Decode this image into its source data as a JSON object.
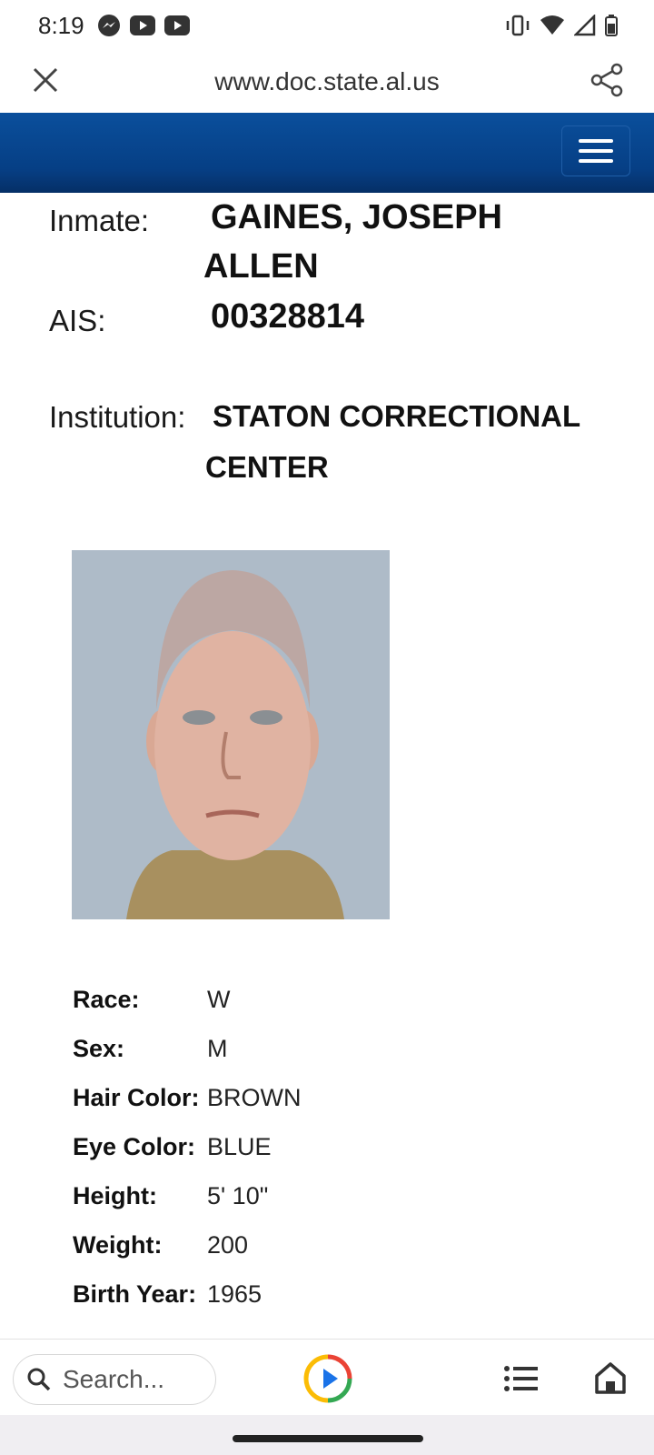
{
  "status": {
    "time": "8:19",
    "icons": [
      "messenger-icon",
      "youtube-icon",
      "youtube-icon",
      "vibrate-icon",
      "wifi-icon",
      "signal-icon",
      "battery-icon"
    ]
  },
  "browser": {
    "url": "www.doc.state.al.us",
    "icons": [
      "close-icon",
      "share-icon"
    ]
  },
  "site": {
    "header_color": "#063f85",
    "menu_icon": "hamburger-icon"
  },
  "inmate": {
    "name_label": "Inmate:",
    "name_line1": "GAINES, JOSEPH",
    "name_line2": "ALLEN",
    "ais_label": "AIS:",
    "ais": "00328814",
    "institution_label": "Institution:",
    "institution_line1": "STATON CORRECTIONAL",
    "institution_line2": "CENTER"
  },
  "attributes": [
    {
      "label": "Race:",
      "value": "W"
    },
    {
      "label": "Sex:",
      "value": "M"
    },
    {
      "label": "Hair Color:",
      "value": "BROWN"
    },
    {
      "label": "Eye Color:",
      "value": "BLUE"
    },
    {
      "label": "Height:",
      "value": "5' 10\""
    },
    {
      "label": "Weight:",
      "value": "200"
    },
    {
      "label": "Birth Year:",
      "value": "1965"
    }
  ],
  "bottom": {
    "search_placeholder": "Search...",
    "icons": [
      "search-icon",
      "play-icon",
      "list-icon",
      "home-icon"
    ]
  }
}
